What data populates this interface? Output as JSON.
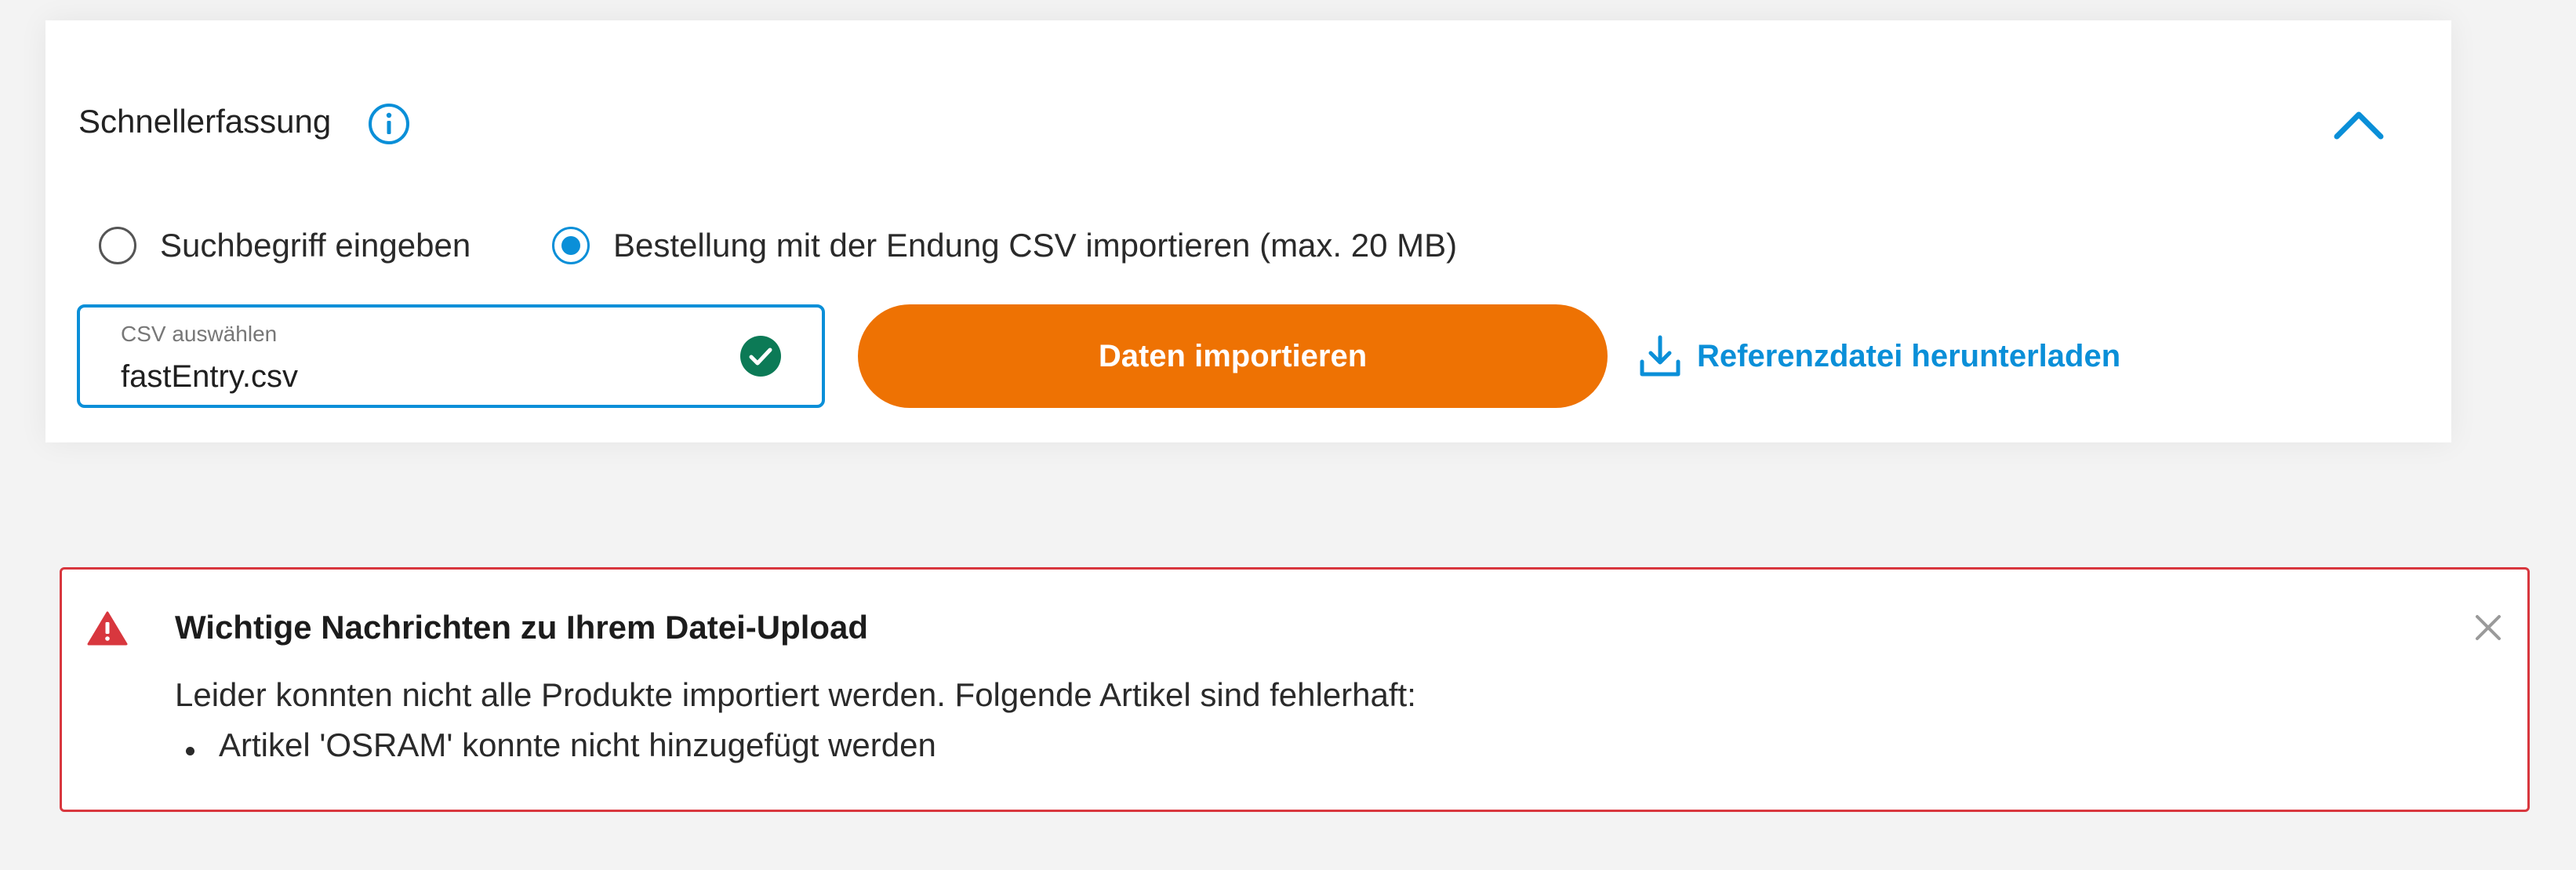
{
  "quick_entry": {
    "title": "Schnellerfassung",
    "info_icon": "info-icon",
    "collapse_icon": "chevron-up-icon",
    "options": [
      {
        "label": "Suchbegriff eingeben",
        "selected": false
      },
      {
        "label": "Bestellung mit der Endung CSV importieren (max. 20 MB)",
        "selected": true
      }
    ],
    "file_input": {
      "label": "CSV auswählen",
      "value": "fastEntry.csv",
      "status_icon": "check-circle-icon"
    },
    "import_button_label": "Daten importieren",
    "download_link_label": "Referenzdatei herunterladen",
    "download_icon": "download-icon"
  },
  "alert": {
    "icon": "warning-icon",
    "title": "Wichtige Nachrichten zu Ihrem Datei-Upload",
    "message": "Leider konnten nicht alle Produkte importiert werden. Folgende Artikel sind fehlerhaft:",
    "items": [
      "Artikel 'OSRAM' konnte nicht hinzugefügt werden"
    ],
    "close_icon": "close-icon"
  },
  "colors": {
    "accent_blue": "#0a8fd8",
    "button_orange": "#ee7203",
    "success_green": "#0c7a56",
    "alert_red": "#d8373e"
  }
}
